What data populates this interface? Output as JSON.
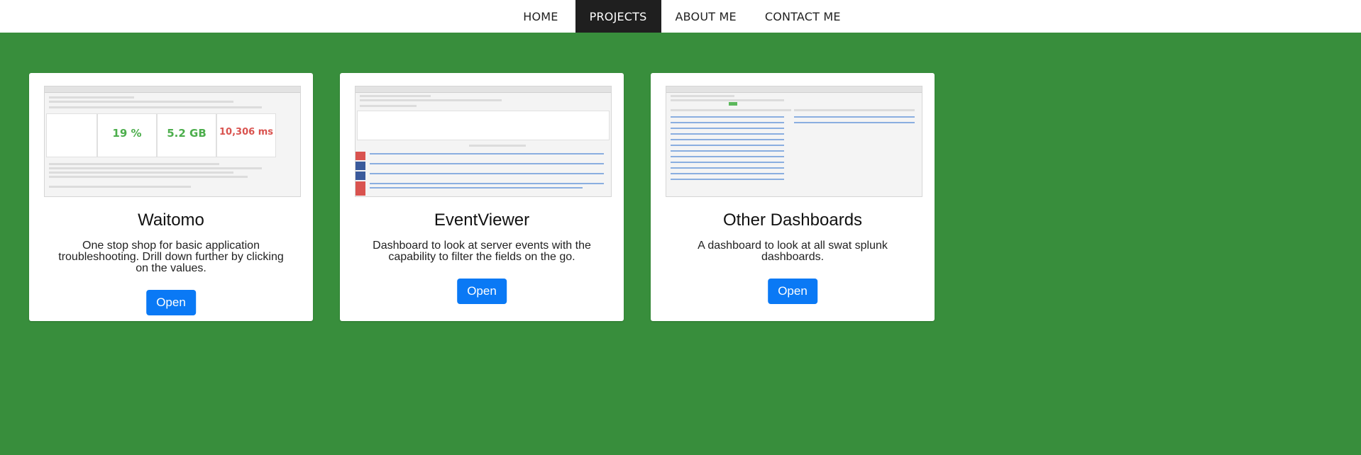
{
  "nav": {
    "items": [
      {
        "label": "HOME"
      },
      {
        "label": "PROJECTS"
      },
      {
        "label": "ABOUT ME"
      },
      {
        "label": "CONTACT ME"
      }
    ]
  },
  "cards": [
    {
      "title": "Waitomo",
      "description": "One stop shop for basic application troubleshooting. Drill down further by clicking on the values.",
      "button": "Open",
      "thumb": {
        "stat1": "19 %",
        "stat2": "5.2 GB",
        "stat3": "10,306 ms"
      }
    },
    {
      "title": "EventViewer",
      "description": "Dashboard to look at server events with the capability to filter the fields on the go.",
      "button": "Open"
    },
    {
      "title": "Other Dashboards",
      "description": "A dashboard to look at all swat splunk dashboards.",
      "button": "Open"
    }
  ],
  "colors": {
    "background": "#388e3c",
    "nav_active": "#1f1f1f",
    "button": "#0a79f5"
  }
}
